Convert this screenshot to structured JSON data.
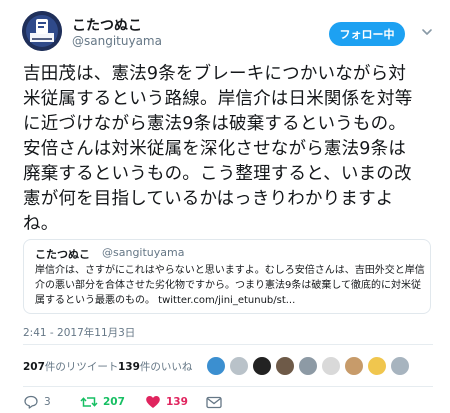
{
  "author": {
    "name": "こたつぬこ",
    "handle": "@sangituyama",
    "follow_label": "フォロー中"
  },
  "tweet_text": "吉田茂は、憲法9条をブレーキにつかいながら対米従属するという路線。岸信介は日米関係を対等に近づけながら憲法9条は破棄するというもの。安倍さんは対米従属を深化させながら憲法9条は廃棄するというもの。こう整理すると、いまの改憲が何を目指しているかはっきりわかりますよね。",
  "quoted": {
    "name": "こたつぬこ",
    "handle": "@sangituyama",
    "text": "岸信介は、さすがにこれはやらないと思いますよ。むしろ安倍さんは、吉田外交と岸信介の悪い部分を合体させた劣化物ですから。つまり憲法9条は破棄して徹底的に対米従属するという最悪のもの。 twitter.com/jini_etunub/st..."
  },
  "timestamp": "2:41 - 2017年11月3日",
  "stats": {
    "retweets_count": "207",
    "retweets_label": "件のリツイート",
    "likes_count": "139",
    "likes_label": "件のいいね"
  },
  "actions": {
    "replies": "3",
    "retweets": "207",
    "likes": "139"
  },
  "colors": {
    "accent": "#1da1f2",
    "retweet_green": "#17bf63",
    "like_red": "#e0245e",
    "muted": "#657786"
  },
  "icons": [
    "avatar-vote",
    "chevron-down-icon",
    "reply-icon",
    "retweet-icon",
    "heart-icon",
    "mail-icon"
  ]
}
